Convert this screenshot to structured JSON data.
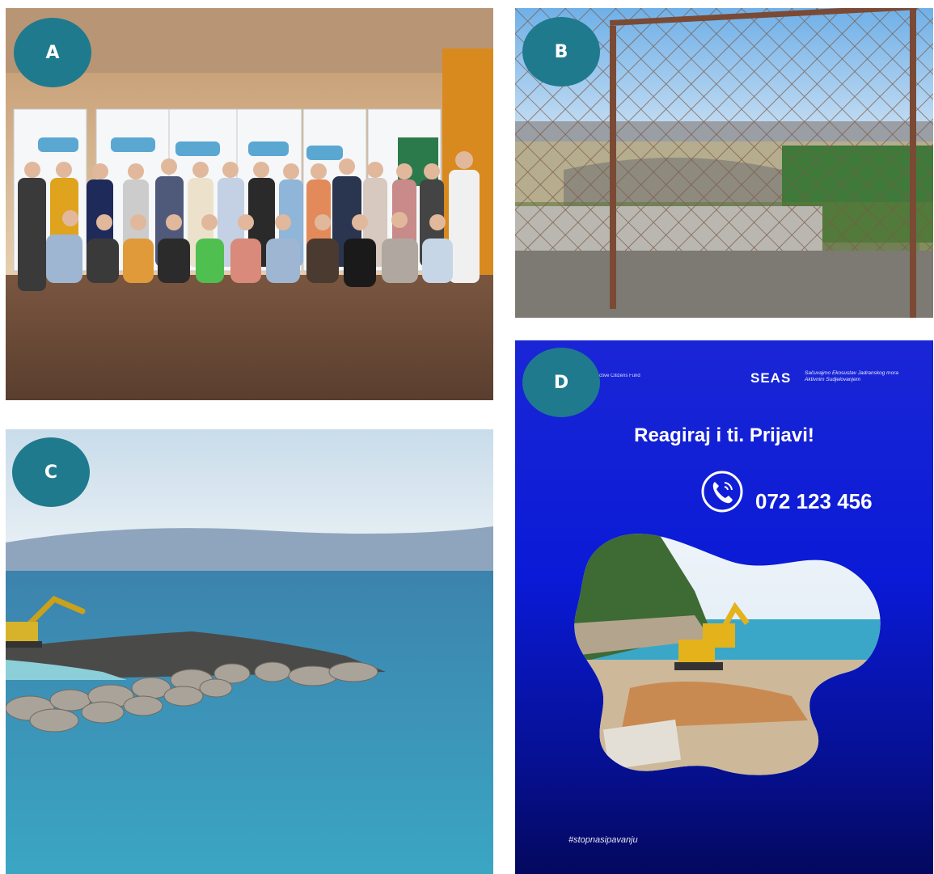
{
  "panels": {
    "a": {
      "label": "A"
    },
    "b": {
      "label": "B"
    },
    "c": {
      "label": "C"
    },
    "d": {
      "label": "D",
      "headline": "Reagiraj i ti. Prijavi!",
      "phone": "072 123 456",
      "brand": "SEAS",
      "brand_tagline": "Sačuvajmo Ekosustav Jadranskog mora Aktivnim Sudjelovanjem",
      "partner_logo_text": "Active Citizens Fund",
      "hashtag": "#stopnasipavanju"
    }
  },
  "colors": {
    "badge": "#1f7a8e",
    "poster_blue": "#0a1ad6",
    "sea": "#2e93b8",
    "sky": "#d9e8f3"
  }
}
